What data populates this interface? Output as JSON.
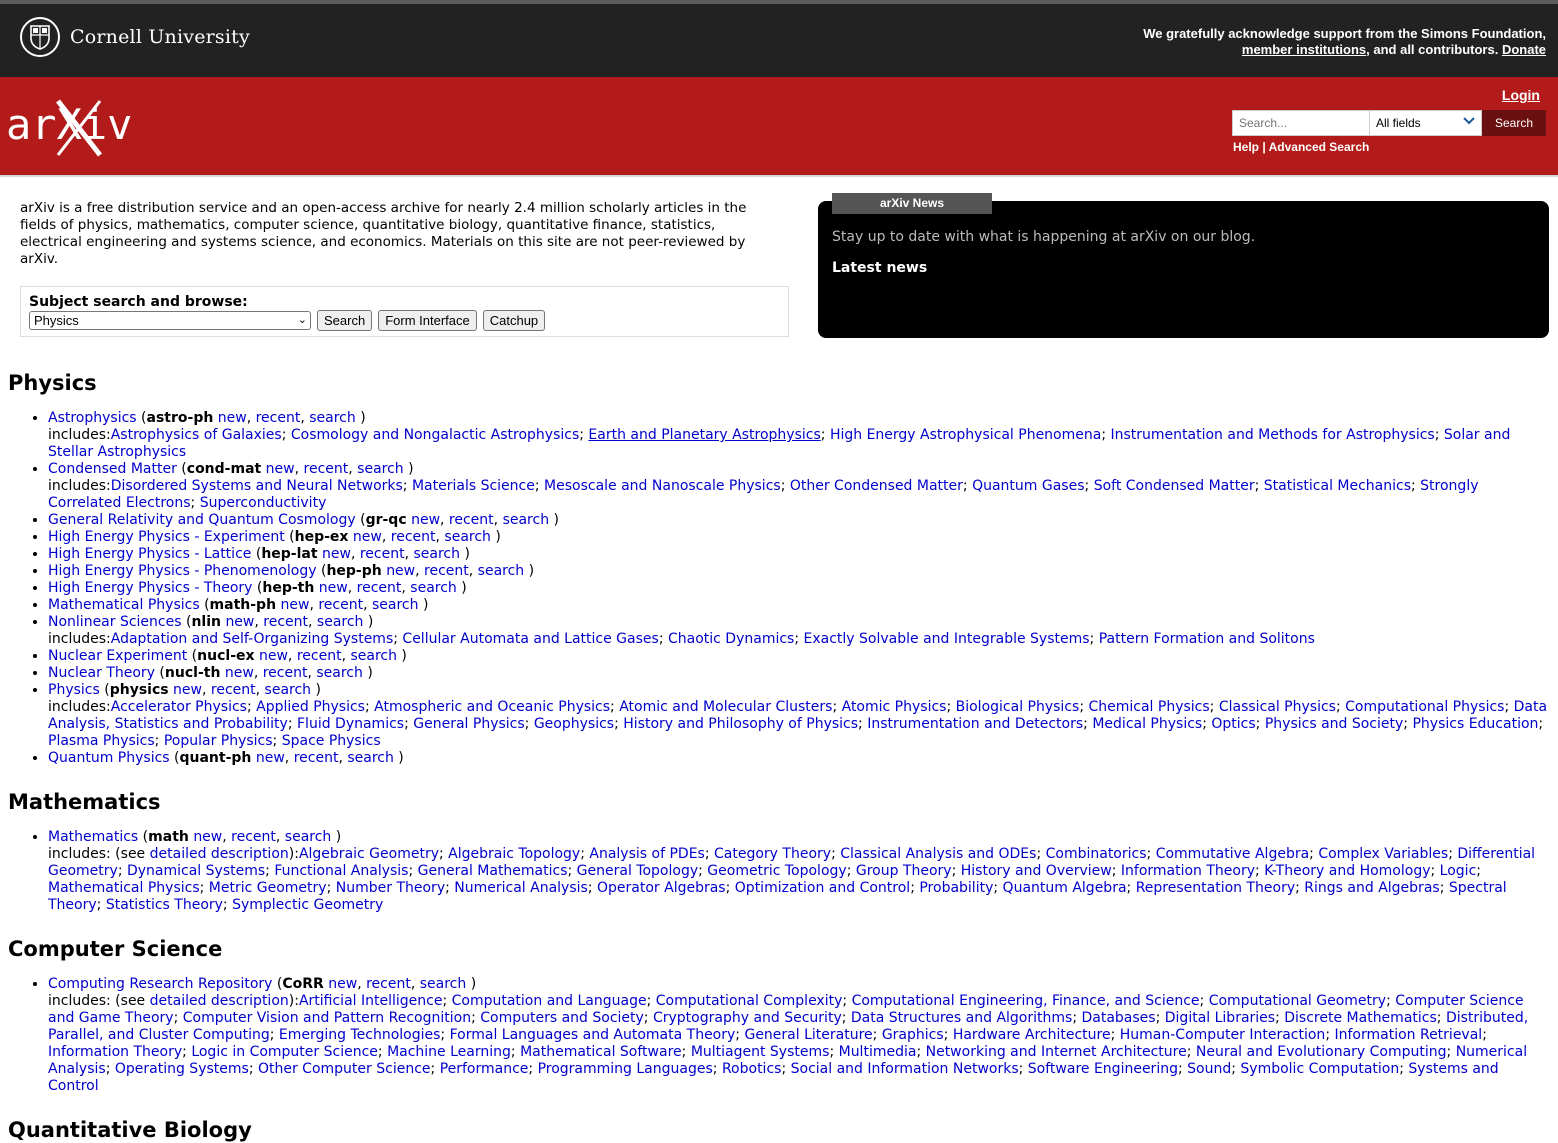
{
  "header": {
    "cornell_name": "Cornell University",
    "ack_line1": "We gratefully acknowledge support from the Simons Foundation,",
    "ack_member": "member institutions",
    "ack_mid": ", and all contributors. ",
    "ack_donate": "Donate"
  },
  "topbar": {
    "logo_text": "arXiv",
    "login": "Login",
    "search_placeholder": "Search...",
    "field_select": "All fields",
    "search_button": "Search",
    "help": "Help",
    "sep": " | ",
    "advanced": "Advanced Search"
  },
  "intro": "arXiv is a free distribution service and an open-access archive for nearly 2.4 million scholarly articles in the fields of physics, mathematics, computer science, quantitative biology, quantitative finance, statistics, electrical engineering and systems science, and economics. Materials on this site are not peer-reviewed by arXiv.",
  "subject_browse": {
    "label": "Subject search and browse:",
    "selected": "Physics",
    "buttons": [
      "Search",
      "Form Interface",
      "Catchup"
    ]
  },
  "news": {
    "tab": "arXiv News",
    "stay": "Stay up to date with what is happening at arXiv on our blog.",
    "latest": "Latest news"
  },
  "sections": [
    {
      "title": "Physics",
      "archives": [
        {
          "name": "Astrophysics",
          "code": "astro-ph",
          "includes": [
            "Astrophysics of Galaxies",
            "Cosmology and Nongalactic Astrophysics",
            "Earth and Planetary Astrophysics",
            "High Energy Astrophysical Phenomena",
            "Instrumentation and Methods for Astrophysics",
            "Solar and Stellar Astrophysics"
          ]
        },
        {
          "name": "Condensed Matter",
          "code": "cond-mat",
          "includes": [
            "Disordered Systems and Neural Networks",
            "Materials Science",
            "Mesoscale and Nanoscale Physics",
            "Other Condensed Matter",
            "Quantum Gases",
            "Soft Condensed Matter",
            "Statistical Mechanics",
            "Strongly Correlated Electrons",
            "Superconductivity"
          ]
        },
        {
          "name": "General Relativity and Quantum Cosmology",
          "code": "gr-qc",
          "includes": []
        },
        {
          "name": "High Energy Physics - Experiment",
          "code": "hep-ex",
          "includes": []
        },
        {
          "name": "High Energy Physics - Lattice",
          "code": "hep-lat",
          "includes": []
        },
        {
          "name": "High Energy Physics - Phenomenology",
          "code": "hep-ph",
          "includes": []
        },
        {
          "name": "High Energy Physics - Theory",
          "code": "hep-th",
          "includes": []
        },
        {
          "name": "Mathematical Physics",
          "code": "math-ph",
          "includes": []
        },
        {
          "name": "Nonlinear Sciences",
          "code": "nlin",
          "includes": [
            "Adaptation and Self-Organizing Systems",
            "Cellular Automata and Lattice Gases",
            "Chaotic Dynamics",
            "Exactly Solvable and Integrable Systems",
            "Pattern Formation and Solitons"
          ]
        },
        {
          "name": "Nuclear Experiment",
          "code": "nucl-ex",
          "includes": []
        },
        {
          "name": "Nuclear Theory",
          "code": "nucl-th",
          "includes": []
        },
        {
          "name": "Physics",
          "code": "physics",
          "includes": [
            "Accelerator Physics",
            "Applied Physics",
            "Atmospheric and Oceanic Physics",
            "Atomic and Molecular Clusters",
            "Atomic Physics",
            "Biological Physics",
            "Chemical Physics",
            "Classical Physics",
            "Computational Physics",
            "Data Analysis, Statistics and Probability",
            "Fluid Dynamics",
            "General Physics",
            "Geophysics",
            "History and Philosophy of Physics",
            "Instrumentation and Detectors",
            "Medical Physics",
            "Optics",
            "Physics and Society",
            "Physics Education",
            "Plasma Physics",
            "Popular Physics",
            "Space Physics"
          ]
        },
        {
          "name": "Quantum Physics",
          "code": "quant-ph",
          "includes": []
        }
      ]
    },
    {
      "title": "Mathematics",
      "archives": [
        {
          "name": "Mathematics",
          "code": "math",
          "detailed": true,
          "includes": [
            "Algebraic Geometry",
            "Algebraic Topology",
            "Analysis of PDEs",
            "Category Theory",
            "Classical Analysis and ODEs",
            "Combinatorics",
            "Commutative Algebra",
            "Complex Variables",
            "Differential Geometry",
            "Dynamical Systems",
            "Functional Analysis",
            "General Mathematics",
            "General Topology",
            "Geometric Topology",
            "Group Theory",
            "History and Overview",
            "Information Theory",
            "K-Theory and Homology",
            "Logic",
            "Mathematical Physics",
            "Metric Geometry",
            "Number Theory",
            "Numerical Analysis",
            "Operator Algebras",
            "Optimization and Control",
            "Probability",
            "Quantum Algebra",
            "Representation Theory",
            "Rings and Algebras",
            "Spectral Theory",
            "Statistics Theory",
            "Symplectic Geometry"
          ]
        }
      ]
    },
    {
      "title": "Computer Science",
      "archives": [
        {
          "name": "Computing Research Repository",
          "code": "CoRR",
          "detailed": true,
          "includes": [
            "Artificial Intelligence",
            "Computation and Language",
            "Computational Complexity",
            "Computational Engineering, Finance, and Science",
            "Computational Geometry",
            "Computer Science and Game Theory",
            "Computer Vision and Pattern Recognition",
            "Computers and Society",
            "Cryptography and Security",
            "Data Structures and Algorithms",
            "Databases",
            "Digital Libraries",
            "Discrete Mathematics",
            "Distributed, Parallel, and Cluster Computing",
            "Emerging Technologies",
            "Formal Languages and Automata Theory",
            "General Literature",
            "Graphics",
            "Hardware Architecture",
            "Human-Computer Interaction",
            "Information Retrieval",
            "Information Theory",
            "Logic in Computer Science",
            "Machine Learning",
            "Mathematical Software",
            "Multiagent Systems",
            "Multimedia",
            "Networking and Internet Architecture",
            "Neural and Evolutionary Computing",
            "Numerical Analysis",
            "Operating Systems",
            "Other Computer Science",
            "Performance",
            "Programming Languages",
            "Robotics",
            "Social and Information Networks",
            "Software Engineering",
            "Sound",
            "Symbolic Computation",
            "Systems and Control"
          ]
        }
      ]
    },
    {
      "title": "Quantitative Biology",
      "archives": []
    }
  ],
  "labels": {
    "new": "new",
    "recent": "recent",
    "search": "search",
    "includes": "includes:",
    "includes_see": "includes: (see ",
    "detailed": "detailed description",
    "detailed_close": "):"
  },
  "colors": {
    "link": "#0000cc",
    "brand_red": "#b31b1b",
    "cornell_bar": "#222222"
  }
}
